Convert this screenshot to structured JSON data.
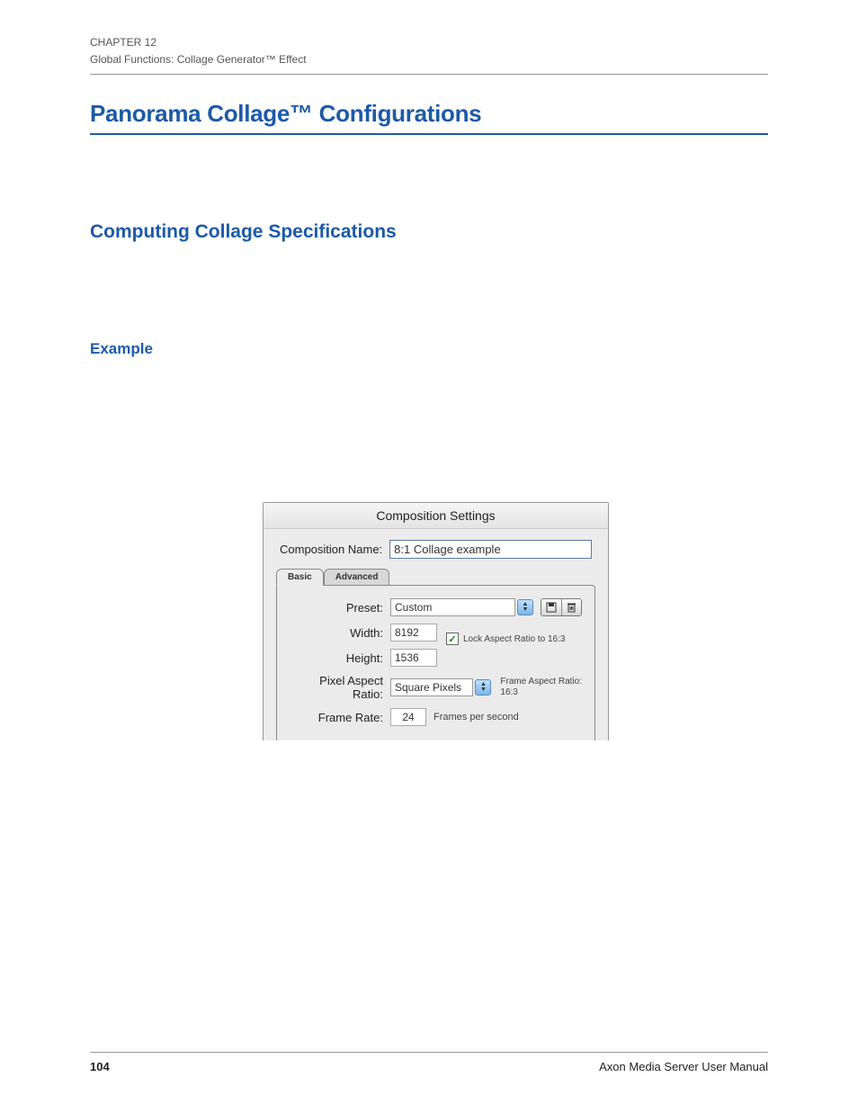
{
  "header": {
    "chapter": "CHAPTER 12",
    "subtitle": "Global Functions: Collage Generator™ Effect"
  },
  "h1": "Panorama Collage™ Configurations",
  "h2": "Computing Collage Specifications",
  "h3": "Example",
  "dialog": {
    "title": "Composition Settings",
    "comp_name_label": "Composition Name:",
    "comp_name_value": "8:1 Collage example",
    "tabs": {
      "basic": "Basic",
      "advanced": "Advanced"
    },
    "preset_label": "Preset:",
    "preset_value": "Custom",
    "width_label": "Width:",
    "width_value": "8192",
    "height_label": "Height:",
    "height_value": "1536",
    "lock_label": "Lock Aspect Ratio to 16:3",
    "lock_checked": "✓",
    "par_label": "Pixel Aspect Ratio:",
    "par_value": "Square Pixels",
    "far_label_top": "Frame Aspect Ratio:",
    "far_label_bottom": "16:3",
    "frame_rate_label": "Frame Rate:",
    "frame_rate_value": "24",
    "fps_text": "Frames per second"
  },
  "footer": {
    "page": "104",
    "manual": "Axon Media Server User Manual"
  }
}
